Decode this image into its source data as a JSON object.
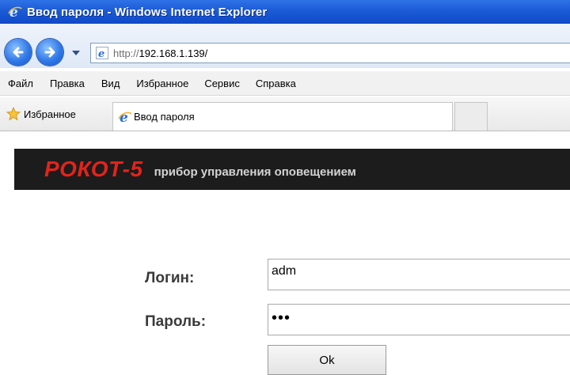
{
  "window": {
    "title": "Ввод пароля - Windows Internet Explorer",
    "icon": "ie-logo-icon"
  },
  "address_bar": {
    "protocol": "http://",
    "host": "192.168.1.139/"
  },
  "menu": [
    "Файл",
    "Правка",
    "Вид",
    "Избранное",
    "Сервис",
    "Справка"
  ],
  "favorites_bar": {
    "favorites_label": "Избранное",
    "tab_title": "Ввод пароля"
  },
  "page": {
    "brand": "РОКОТ-5",
    "tagline": "прибор управления оповещением",
    "login_label": "Логин:",
    "login_value": "adm",
    "password_label": "Пароль:",
    "password_value": "•••",
    "ok_label": "Ok"
  },
  "colors": {
    "titlebar": "#1c5bd6",
    "banner_bg": "#1c1c1c",
    "brand": "#e3231c",
    "tagline": "#d4d4d4"
  }
}
